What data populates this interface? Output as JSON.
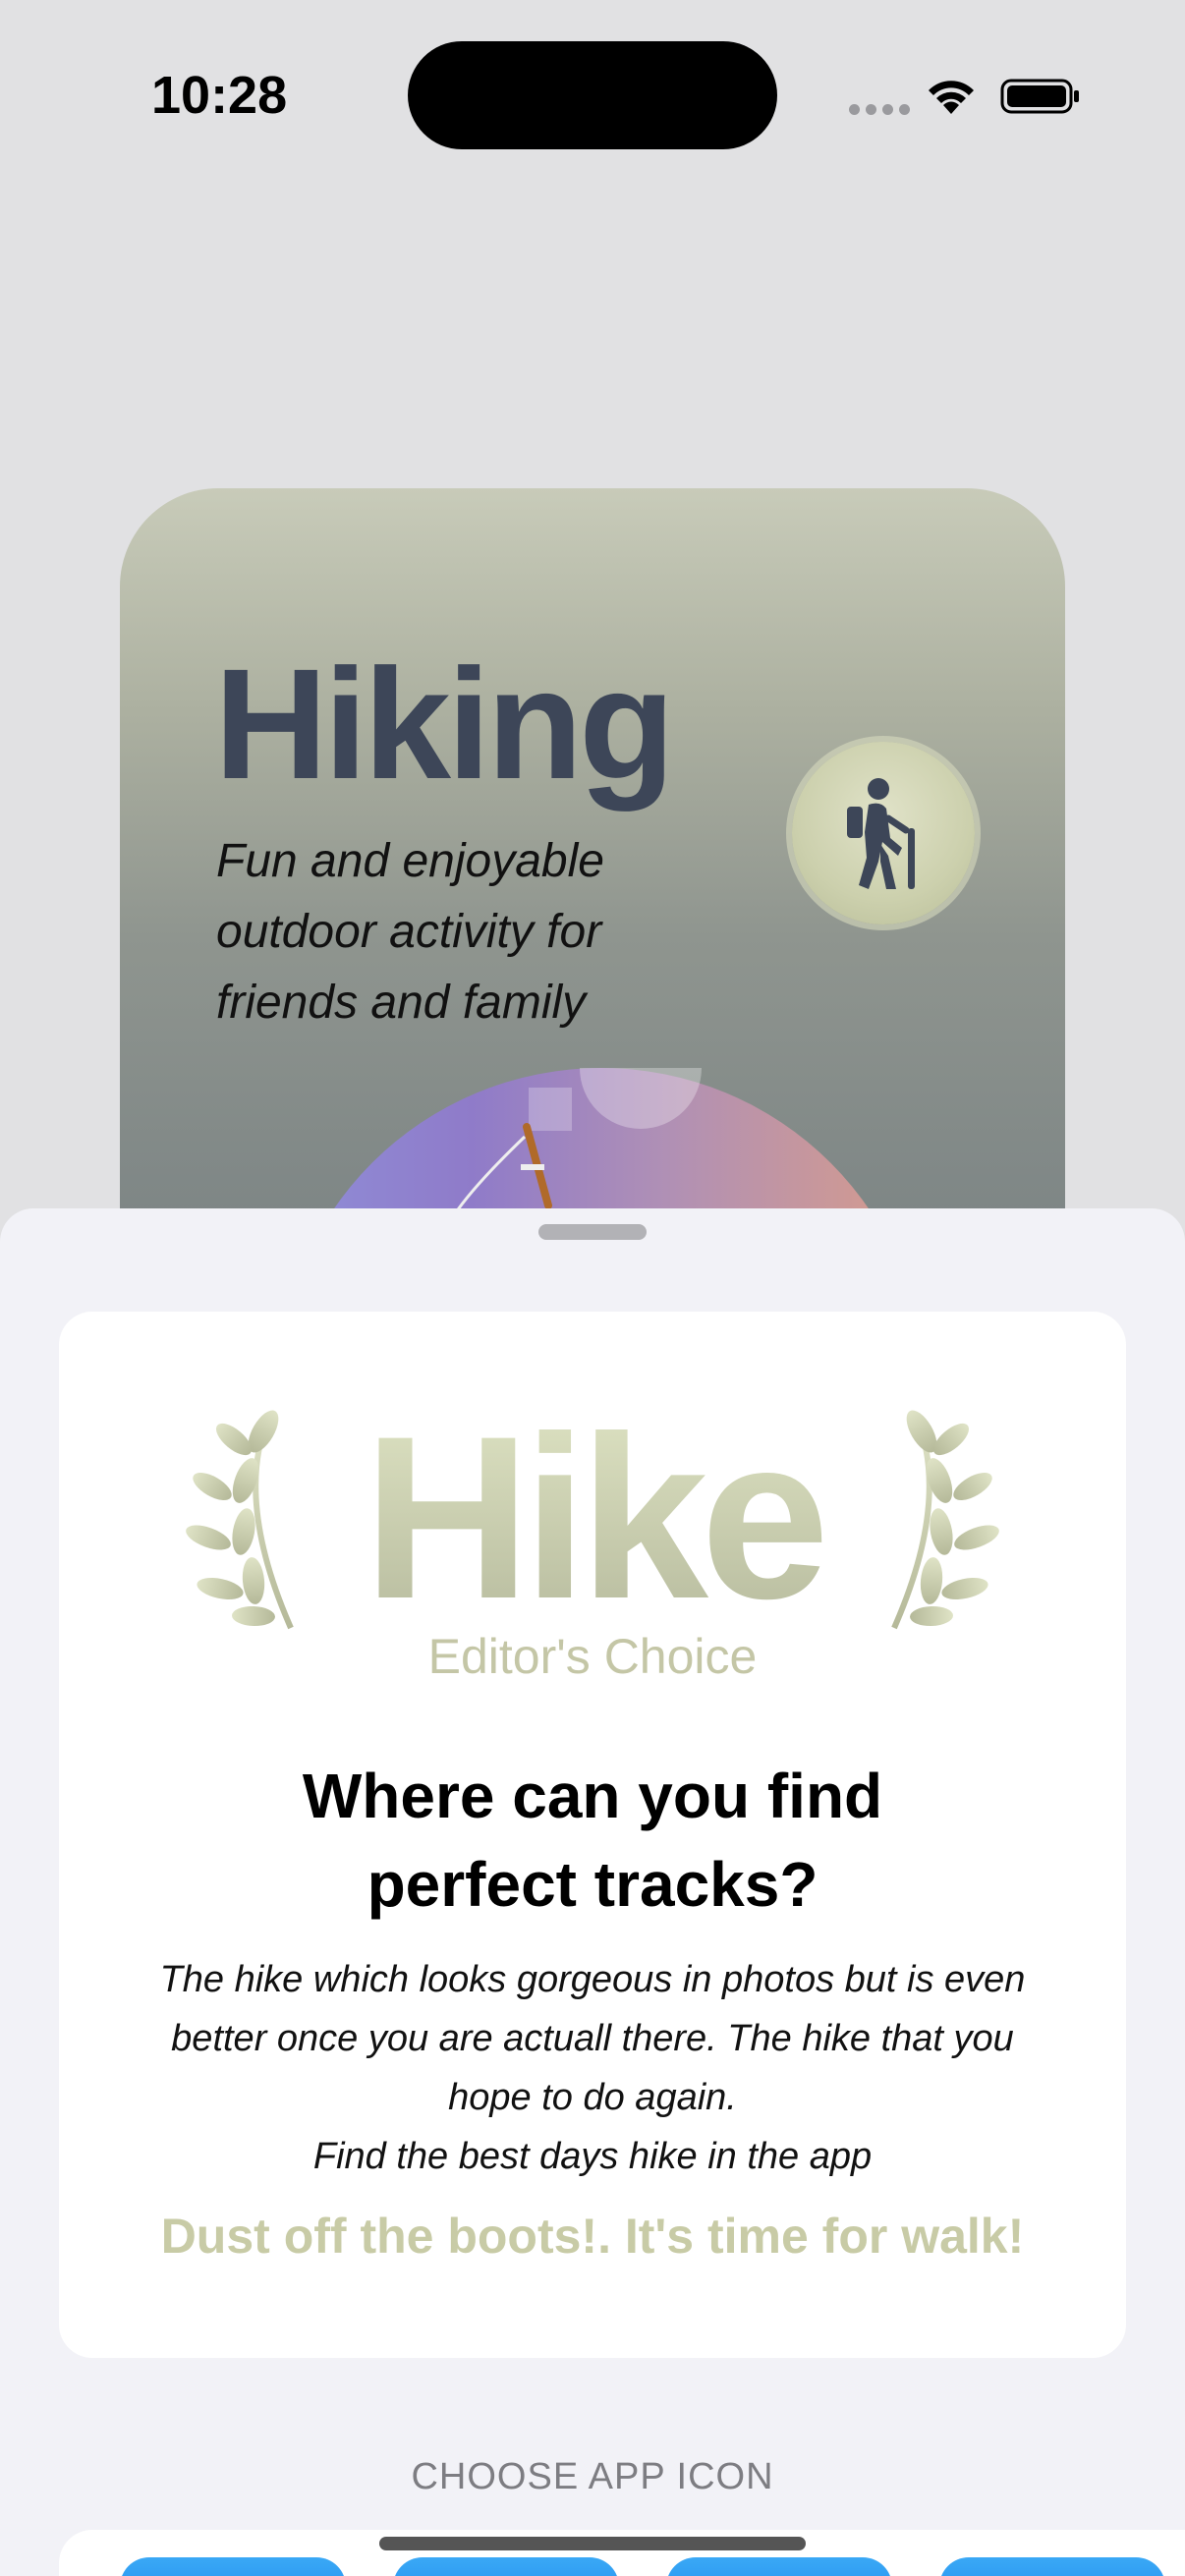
{
  "status_bar": {
    "time": "10:28"
  },
  "hero": {
    "title": "Hiking",
    "subtitle": "Fun and enjoyable outdoor activity for friends and family",
    "badge_icon": "hiker-icon"
  },
  "sheet": {
    "award": {
      "title": "Hike",
      "caption": "Editor's Choice",
      "icon": "laurel-icon"
    },
    "question": "Where can you find perfect tracks?",
    "description_lines": [
      "The hike which looks gorgeous in photos but is even",
      "better once you are actuall there. The hike that you",
      "hope to do again.",
      "Find the best days hike in the app"
    ],
    "cta": "Dust off the boots!. It's time for walk!",
    "section_header": "CHOOSE APP ICON"
  },
  "colors": {
    "accent": "#c8cba6",
    "title": "#3d4658",
    "sheet_bg": "#f2f2f7"
  }
}
